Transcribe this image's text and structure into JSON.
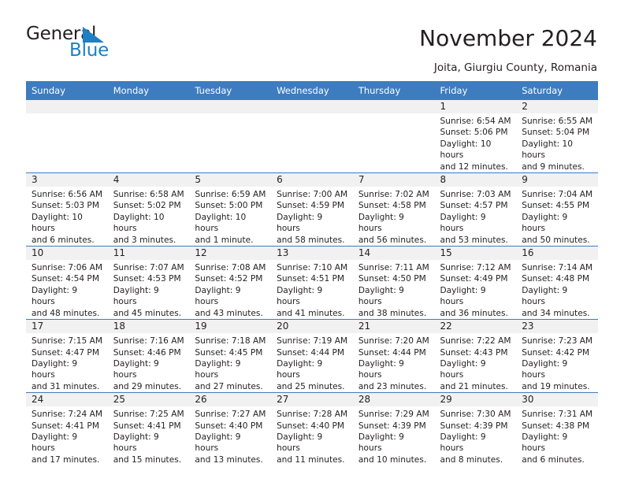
{
  "brand": {
    "name_part1": "General",
    "name_part2": "Blue",
    "triangle_color": "#1f7fc4",
    "text_color": "#231f20"
  },
  "header": {
    "title": "November 2024",
    "subtitle": "Joita, Giurgiu County, Romania"
  },
  "theme": {
    "header_blue": "#3c7cbf",
    "daynum_band": "#f1f1f1",
    "text": "#231f20"
  },
  "calendar": {
    "weekday_headers": [
      "Sunday",
      "Monday",
      "Tuesday",
      "Wednesday",
      "Thursday",
      "Friday",
      "Saturday"
    ],
    "weeks": [
      [
        {
          "day": "",
          "info": ""
        },
        {
          "day": "",
          "info": ""
        },
        {
          "day": "",
          "info": ""
        },
        {
          "day": "",
          "info": ""
        },
        {
          "day": "",
          "info": ""
        },
        {
          "day": "1",
          "info": "Sunrise: 6:54 AM\nSunset: 5:06 PM\nDaylight: 10 hours\nand 12 minutes."
        },
        {
          "day": "2",
          "info": "Sunrise: 6:55 AM\nSunset: 5:04 PM\nDaylight: 10 hours\nand 9 minutes."
        }
      ],
      [
        {
          "day": "3",
          "info": "Sunrise: 6:56 AM\nSunset: 5:03 PM\nDaylight: 10 hours\nand 6 minutes."
        },
        {
          "day": "4",
          "info": "Sunrise: 6:58 AM\nSunset: 5:02 PM\nDaylight: 10 hours\nand 3 minutes."
        },
        {
          "day": "5",
          "info": "Sunrise: 6:59 AM\nSunset: 5:00 PM\nDaylight: 10 hours\nand 1 minute."
        },
        {
          "day": "6",
          "info": "Sunrise: 7:00 AM\nSunset: 4:59 PM\nDaylight: 9 hours\nand 58 minutes."
        },
        {
          "day": "7",
          "info": "Sunrise: 7:02 AM\nSunset: 4:58 PM\nDaylight: 9 hours\nand 56 minutes."
        },
        {
          "day": "8",
          "info": "Sunrise: 7:03 AM\nSunset: 4:57 PM\nDaylight: 9 hours\nand 53 minutes."
        },
        {
          "day": "9",
          "info": "Sunrise: 7:04 AM\nSunset: 4:55 PM\nDaylight: 9 hours\nand 50 minutes."
        }
      ],
      [
        {
          "day": "10",
          "info": "Sunrise: 7:06 AM\nSunset: 4:54 PM\nDaylight: 9 hours\nand 48 minutes."
        },
        {
          "day": "11",
          "info": "Sunrise: 7:07 AM\nSunset: 4:53 PM\nDaylight: 9 hours\nand 45 minutes."
        },
        {
          "day": "12",
          "info": "Sunrise: 7:08 AM\nSunset: 4:52 PM\nDaylight: 9 hours\nand 43 minutes."
        },
        {
          "day": "13",
          "info": "Sunrise: 7:10 AM\nSunset: 4:51 PM\nDaylight: 9 hours\nand 41 minutes."
        },
        {
          "day": "14",
          "info": "Sunrise: 7:11 AM\nSunset: 4:50 PM\nDaylight: 9 hours\nand 38 minutes."
        },
        {
          "day": "15",
          "info": "Sunrise: 7:12 AM\nSunset: 4:49 PM\nDaylight: 9 hours\nand 36 minutes."
        },
        {
          "day": "16",
          "info": "Sunrise: 7:14 AM\nSunset: 4:48 PM\nDaylight: 9 hours\nand 34 minutes."
        }
      ],
      [
        {
          "day": "17",
          "info": "Sunrise: 7:15 AM\nSunset: 4:47 PM\nDaylight: 9 hours\nand 31 minutes."
        },
        {
          "day": "18",
          "info": "Sunrise: 7:16 AM\nSunset: 4:46 PM\nDaylight: 9 hours\nand 29 minutes."
        },
        {
          "day": "19",
          "info": "Sunrise: 7:18 AM\nSunset: 4:45 PM\nDaylight: 9 hours\nand 27 minutes."
        },
        {
          "day": "20",
          "info": "Sunrise: 7:19 AM\nSunset: 4:44 PM\nDaylight: 9 hours\nand 25 minutes."
        },
        {
          "day": "21",
          "info": "Sunrise: 7:20 AM\nSunset: 4:44 PM\nDaylight: 9 hours\nand 23 minutes."
        },
        {
          "day": "22",
          "info": "Sunrise: 7:22 AM\nSunset: 4:43 PM\nDaylight: 9 hours\nand 21 minutes."
        },
        {
          "day": "23",
          "info": "Sunrise: 7:23 AM\nSunset: 4:42 PM\nDaylight: 9 hours\nand 19 minutes."
        }
      ],
      [
        {
          "day": "24",
          "info": "Sunrise: 7:24 AM\nSunset: 4:41 PM\nDaylight: 9 hours\nand 17 minutes."
        },
        {
          "day": "25",
          "info": "Sunrise: 7:25 AM\nSunset: 4:41 PM\nDaylight: 9 hours\nand 15 minutes."
        },
        {
          "day": "26",
          "info": "Sunrise: 7:27 AM\nSunset: 4:40 PM\nDaylight: 9 hours\nand 13 minutes."
        },
        {
          "day": "27",
          "info": "Sunrise: 7:28 AM\nSunset: 4:40 PM\nDaylight: 9 hours\nand 11 minutes."
        },
        {
          "day": "28",
          "info": "Sunrise: 7:29 AM\nSunset: 4:39 PM\nDaylight: 9 hours\nand 10 minutes."
        },
        {
          "day": "29",
          "info": "Sunrise: 7:30 AM\nSunset: 4:39 PM\nDaylight: 9 hours\nand 8 minutes."
        },
        {
          "day": "30",
          "info": "Sunrise: 7:31 AM\nSunset: 4:38 PM\nDaylight: 9 hours\nand 6 minutes."
        }
      ]
    ]
  }
}
